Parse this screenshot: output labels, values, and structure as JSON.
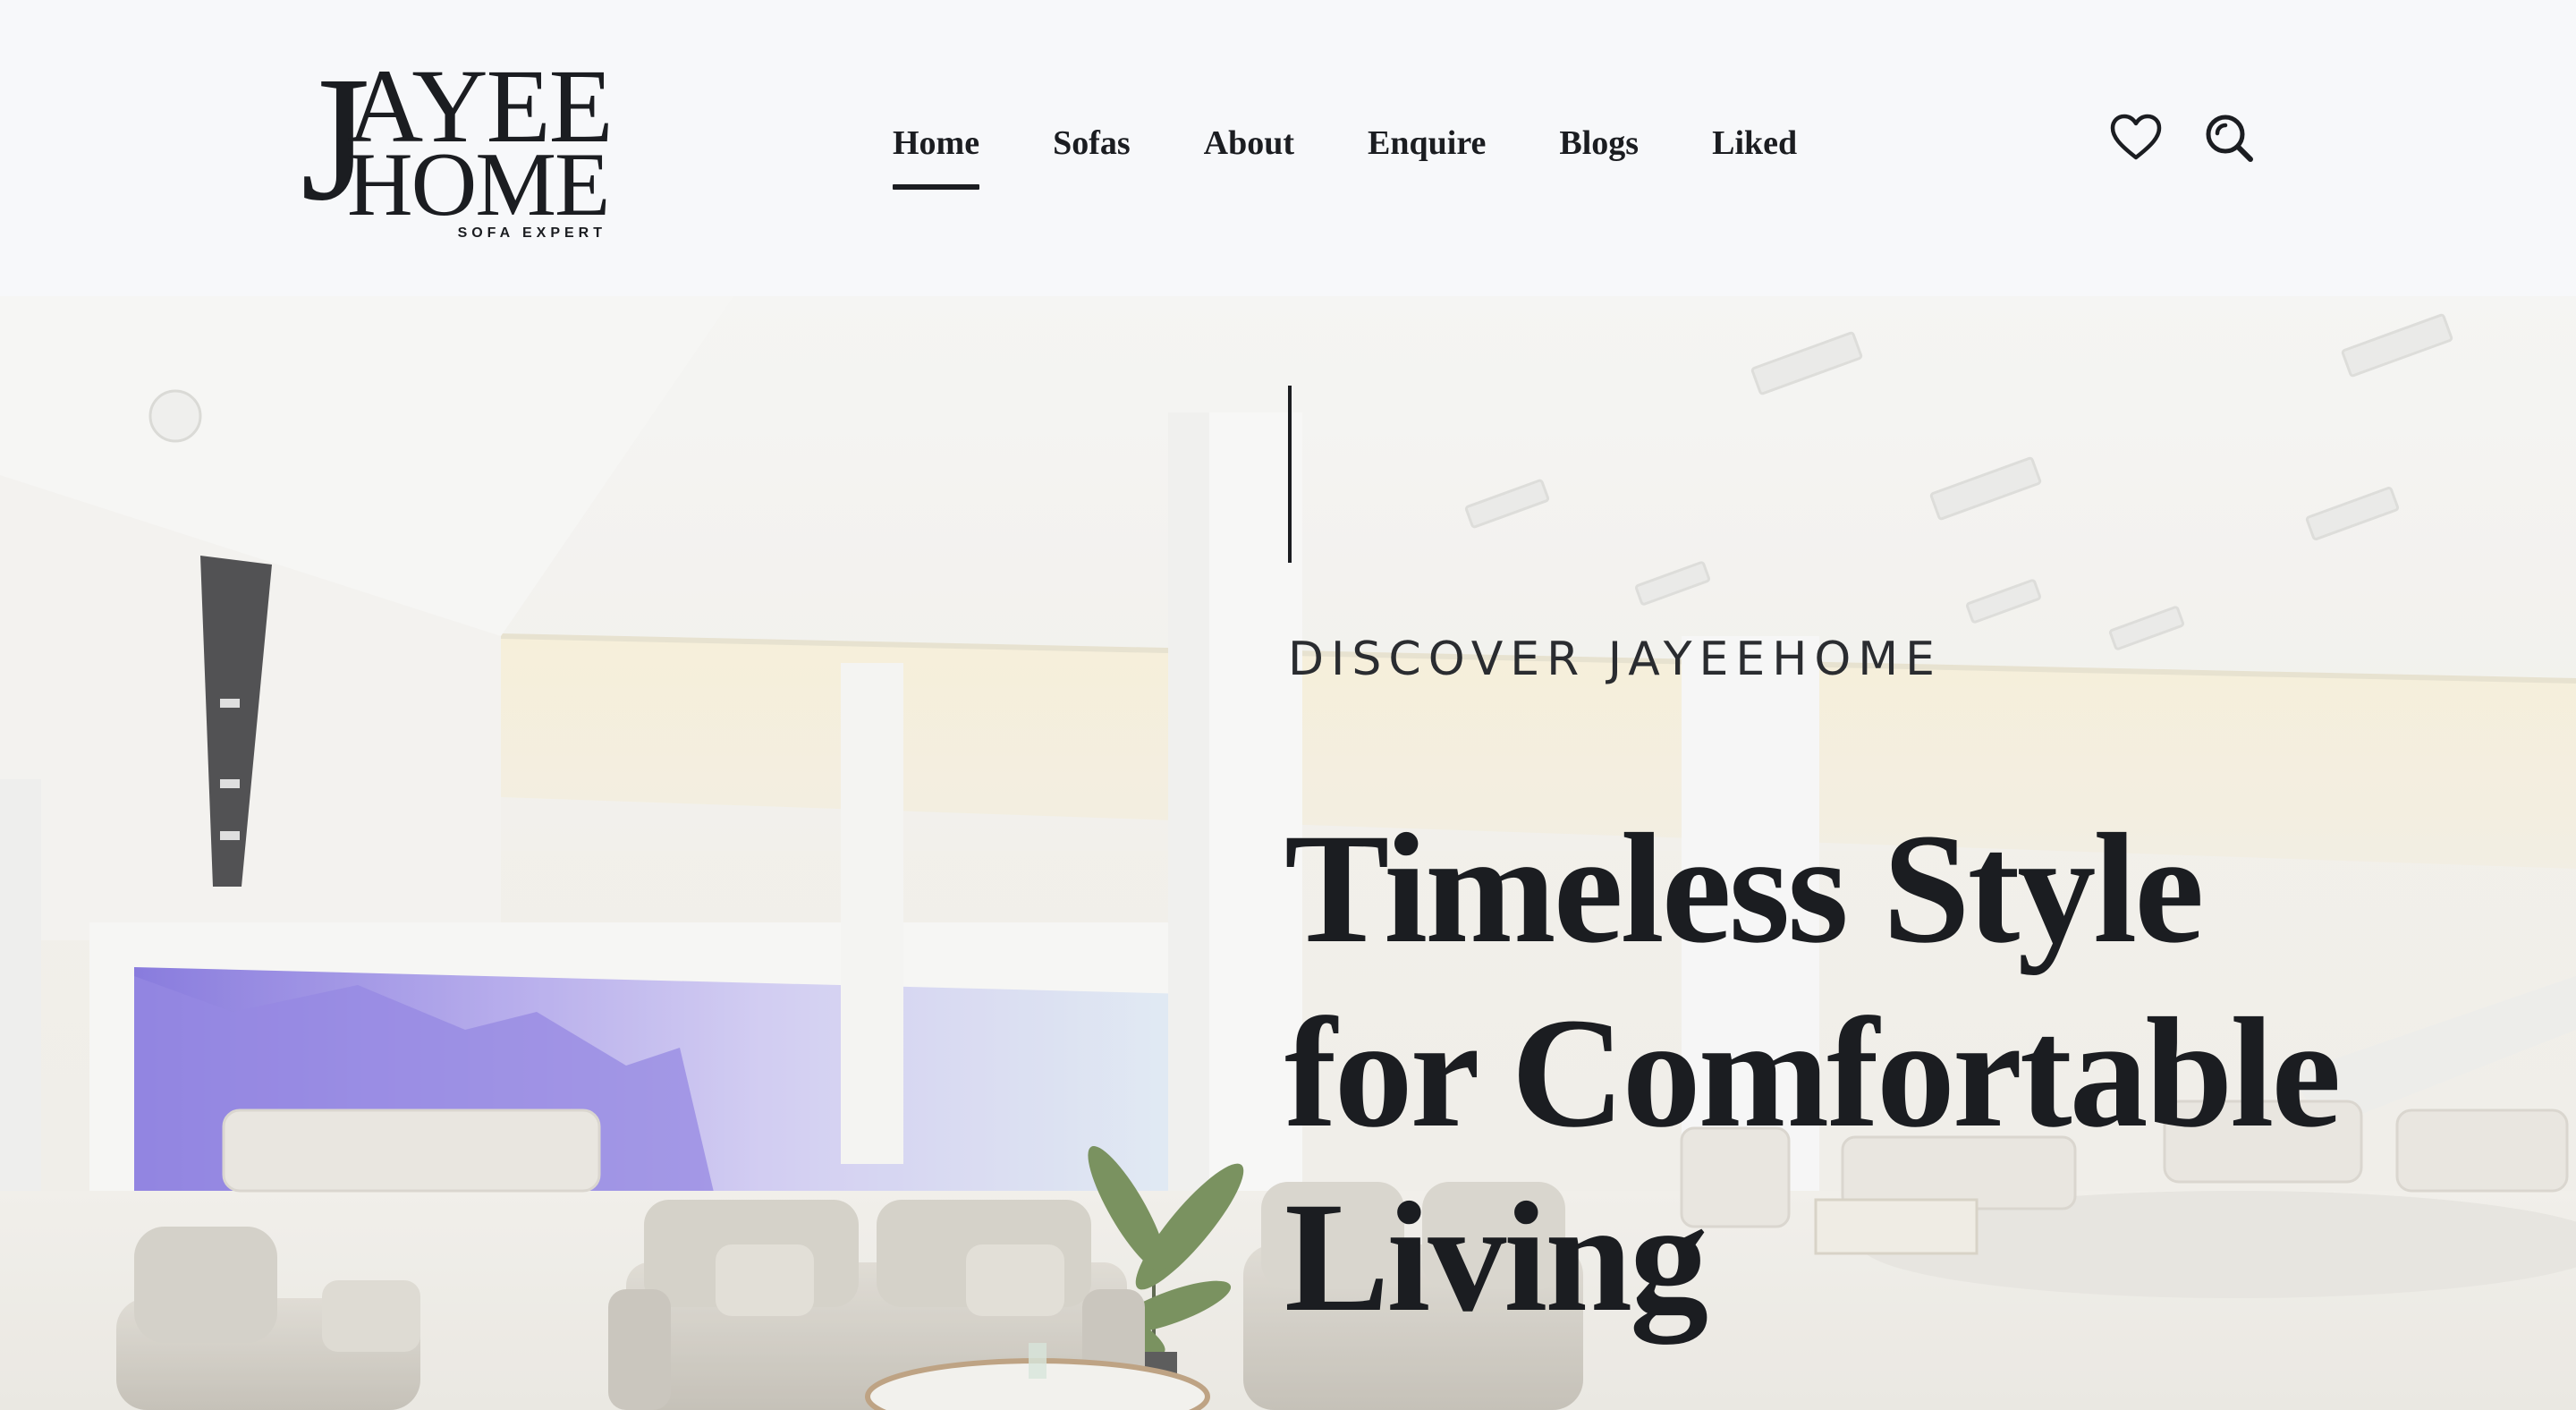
{
  "logo": {
    "initial": "J",
    "line1": "AYEE",
    "line2": "HOME",
    "tagline": "SOFA EXPERT"
  },
  "nav": {
    "items": [
      {
        "label": "Home",
        "active": true
      },
      {
        "label": "Sofas",
        "active": false
      },
      {
        "label": "About",
        "active": false
      },
      {
        "label": "Enquire",
        "active": false
      },
      {
        "label": "Blogs",
        "active": false
      },
      {
        "label": "Liked",
        "active": false
      }
    ]
  },
  "header_icons": [
    "heart-icon",
    "search-icon"
  ],
  "hero": {
    "eyebrow": "DISCOVER JAYEEHOME",
    "heading": "Timeless Style for Comfortable Living",
    "image": "sofa-showroom-photo"
  },
  "colors": {
    "header_bg": "#f7f8fa",
    "text": "#1b1d21",
    "mural_purple": "#8a7ae0"
  }
}
